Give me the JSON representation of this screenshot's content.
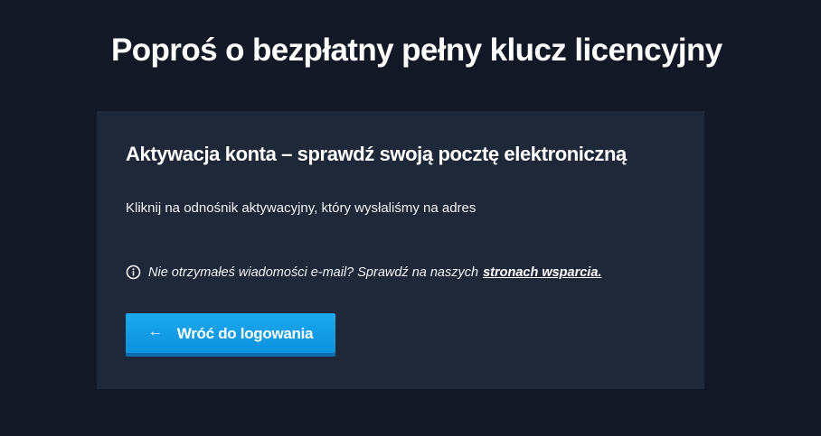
{
  "page": {
    "title": "Poproś o bezpłatny pełny klucz licencyjny"
  },
  "card": {
    "heading": "Aktywacja konta – sprawdź swoją pocztę elektroniczną",
    "message": "Kliknij na odnośnik aktywacyjny, który wysłaliśmy na adres",
    "notice": {
      "icon": "info-icon",
      "text": "Nie otrzymałeś wiadomości e-mail? Sprawdź na naszych",
      "link_label": "stronach wsparcia."
    },
    "button": {
      "icon": "arrow-left-icon",
      "label": "Wróć do logowania"
    }
  },
  "colors": {
    "background": "#121826",
    "card": "#1e2839",
    "accent": "#1aa9ef"
  }
}
